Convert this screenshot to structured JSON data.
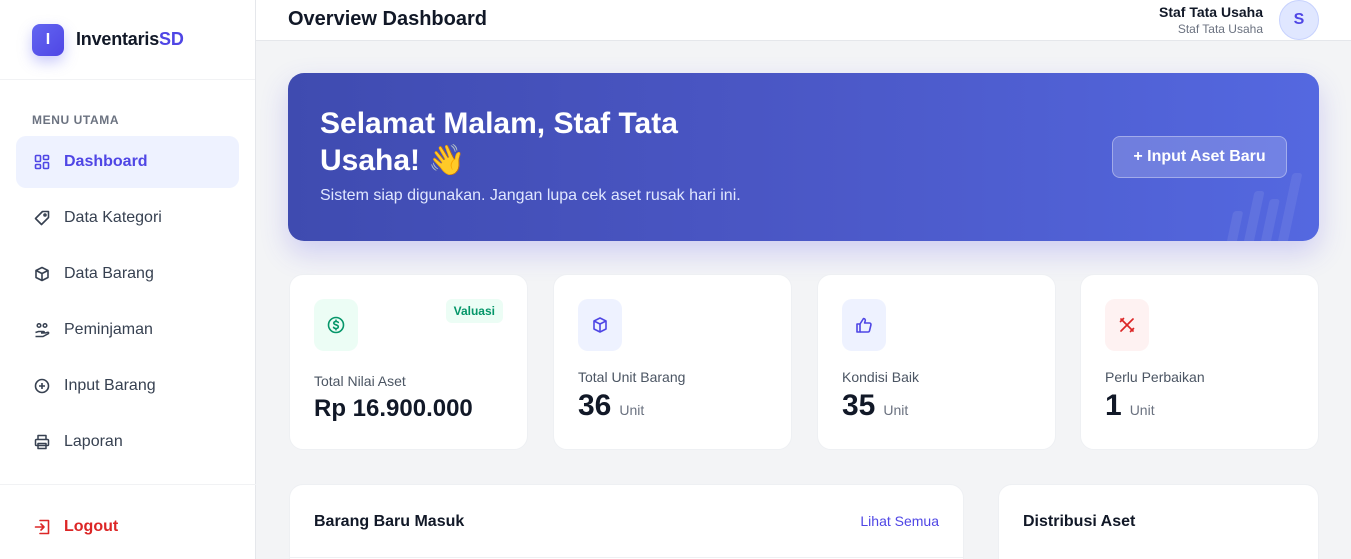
{
  "brand": {
    "logo_letter": "I",
    "name_main": "Inventaris",
    "name_accent": "SD"
  },
  "sidebar": {
    "heading": "MENU UTAMA",
    "items": [
      {
        "label": "Dashboard",
        "icon": "grid-icon",
        "active": true
      },
      {
        "label": "Data Kategori",
        "icon": "tag-icon"
      },
      {
        "label": "Data Barang",
        "icon": "box-icon"
      },
      {
        "label": "Peminjaman",
        "icon": "hand-people-icon"
      },
      {
        "label": "Input Barang",
        "icon": "plus-circle-icon"
      },
      {
        "label": "Laporan",
        "icon": "printer-icon"
      }
    ],
    "logout_label": "Logout"
  },
  "header": {
    "title": "Overview Dashboard",
    "user_name": "Staf Tata Usaha",
    "user_role": "Staf Tata Usaha",
    "avatar_letter": "S"
  },
  "hero": {
    "greeting": "Selamat Malam, Staf Tata Usaha! 👋",
    "subtitle": "Sistem siap digunakan. Jangan lupa cek aset rusak hari ini.",
    "button_label": "+ Input Aset Baru"
  },
  "stats": [
    {
      "label": "Total Nilai Aset",
      "value": "Rp 16.900.000",
      "unit": "",
      "badge": "Valuasi",
      "icon": "dollar-circle-icon",
      "color": "#059669"
    },
    {
      "label": "Total Unit Barang",
      "value": "36",
      "unit": "Unit",
      "icon": "cube-icon",
      "color": "#4f46e5"
    },
    {
      "label": "Kondisi Baik",
      "value": "35",
      "unit": "Unit",
      "icon": "thumbs-up-icon",
      "color": "#4f46e5"
    },
    {
      "label": "Perlu Perbaikan",
      "value": "1",
      "unit": "Unit",
      "icon": "wrench-cross-icon",
      "color": "#dc2626"
    }
  ],
  "panels": {
    "recent": {
      "title": "Barang Baru Masuk",
      "link": "Lihat Semua"
    },
    "distribution": {
      "title": "Distribusi Aset"
    }
  }
}
